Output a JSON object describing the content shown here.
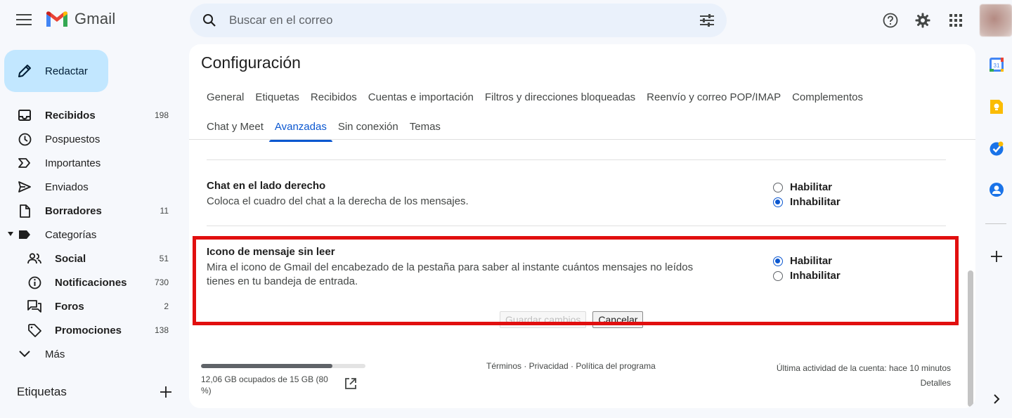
{
  "header": {
    "app_name": "Gmail",
    "search_placeholder": "Buscar en el correo"
  },
  "sidebar": {
    "compose_label": "Redactar",
    "items": [
      {
        "label": "Recibidos",
        "count": "198"
      },
      {
        "label": "Pospuestos",
        "count": ""
      },
      {
        "label": "Importantes",
        "count": ""
      },
      {
        "label": "Enviados",
        "count": ""
      },
      {
        "label": "Borradores",
        "count": "11"
      },
      {
        "label": "Categorías",
        "count": ""
      },
      {
        "label": "Social",
        "count": "51"
      },
      {
        "label": "Notificaciones",
        "count": "730"
      },
      {
        "label": "Foros",
        "count": "2"
      },
      {
        "label": "Promociones",
        "count": "138"
      },
      {
        "label": "Más",
        "count": ""
      }
    ],
    "labels_heading": "Etiquetas"
  },
  "settings": {
    "title": "Configuración",
    "tabs_row1": [
      "General",
      "Etiquetas",
      "Recibidos",
      "Cuentas e importación",
      "Filtros y direcciones bloqueadas",
      "Reenvío y correo POP/IMAP",
      "Complementos"
    ],
    "tabs_row2": [
      "Chat y Meet",
      "Avanzadas",
      "Sin conexión",
      "Temas"
    ],
    "active_tab": "Avanzadas",
    "chat_right": {
      "title": "Chat en el lado derecho",
      "description": "Coloca el cuadro del chat a la derecha de los mensajes.",
      "opt_enable": "Habilitar",
      "opt_disable": "Inhabilitar",
      "selected": "Inhabilitar"
    },
    "unread_icon": {
      "title": "Icono de mensaje sin leer",
      "description": "Mira el icono de Gmail del encabezado de la pestaña para saber al instante cuántos mensajes no leídos tienes en tu bandeja de entrada.",
      "opt_enable": "Habilitar",
      "opt_disable": "Inhabilitar",
      "selected": "Habilitar"
    },
    "save_label": "Guardar cambios",
    "cancel_label": "Cancelar"
  },
  "footer": {
    "storage_text": "12,06 GB ocupados de 15 GB (80 %)",
    "storage_fraction": 0.8,
    "links": "Términos · Privacidad · Política del programa",
    "last_activity": "Última actividad de la cuenta: hace 10 minutos",
    "details": "Detalles"
  },
  "colors": {
    "accent": "#0b57d0",
    "compose_bg": "#c2e7ff",
    "highlight": "#e10f0f",
    "panel_bg": "#ffffff",
    "page_bg": "#f6f8fc"
  },
  "rail": {
    "calendar_day": "31"
  }
}
